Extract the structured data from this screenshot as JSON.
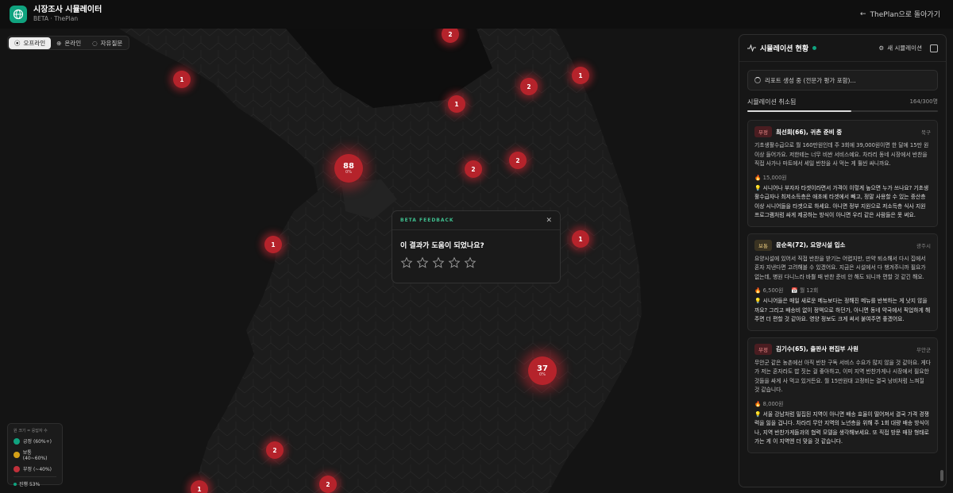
{
  "header": {
    "title": "시장조사 시뮬레이터",
    "subtitle": "BETA · ThePlan",
    "back_label": "ThePlan으로 돌아가기"
  },
  "modes": [
    {
      "label": "오프라인",
      "icon": "location-pin-icon",
      "active": true
    },
    {
      "label": "온라인",
      "icon": "globe-icon",
      "active": false
    },
    {
      "label": "자유질문",
      "icon": "chat-bubble-icon",
      "active": false
    }
  ],
  "clusters": [
    {
      "count": "2",
      "size": "sm"
    },
    {
      "count": "1",
      "size": "sm"
    },
    {
      "count": "2",
      "size": "sm"
    },
    {
      "count": "1",
      "size": "sm"
    },
    {
      "count": "1",
      "size": "sm"
    },
    {
      "count": "88",
      "pct": "0%",
      "size": "lg"
    },
    {
      "count": "2",
      "size": "sm"
    },
    {
      "count": "2",
      "size": "sm"
    },
    {
      "count": "1",
      "size": "sm"
    },
    {
      "count": "1",
      "size": "sm"
    },
    {
      "count": "37",
      "pct": "0%",
      "size": "lg"
    },
    {
      "count": "2",
      "size": "sm"
    },
    {
      "count": "2",
      "size": "sm"
    },
    {
      "count": "1",
      "size": "sm"
    }
  ],
  "legend": {
    "title": "원 크기 = 응답자 수",
    "items": [
      {
        "label": "긍정 (60%+)",
        "color": "#10a37f"
      },
      {
        "label": "보통 (40~60%)",
        "color": "#d4a017"
      },
      {
        "label": "부정 (~40%)",
        "color": "#c0303a"
      }
    ],
    "progress": "진행 53%"
  },
  "feedback": {
    "tag": "BETA FEEDBACK",
    "question": "이 결과가 도움이 되었나요?",
    "stars": 5
  },
  "panel": {
    "title": "시뮬레이션 현황",
    "new_label": "새 시뮬레이션",
    "report_status": "리포트 생성 중 (전문가 평가 포함)...",
    "cancel_label": "시뮬레이션 취소됨",
    "count_label": "164/300명",
    "progress": 0.547,
    "cards": [
      {
        "badge": "부정",
        "tone": "neg",
        "name": "최선희(66), 귀촌 준비 중",
        "location": "북구",
        "body": "기초생활수급으로 월 160만원인데 주 3회에 39,000원이면 한 달에 15만 원 이상 들어가요. 저한테는 너무 비싼 서비스예요. 차라리 동네 시장에서 반찬을 직접 사가나 마트에서 세일 반찬을 사 먹는 게 훨씬 싸니까요.",
        "price": "15,000원",
        "frequency": "",
        "tip": "시니어나 부자자 타겟이라면서 가격이 이렇게 높으면 누가 쓰나요? 기초생활수급자나 최저소득층은 애초에 타겟에서 빼고, 정말 사용할 수 있는 중산층 이상 시니어들을 타겟으로 하세요. 아니면 정부 지원으로 저소득층 식사 지원 프로그램처럼 싸게 제공하는 방식이 아니면 우리 같은 사람들은 못 써요."
      },
      {
        "badge": "보통",
        "tone": "neu",
        "name": "윤순옥(72), 요양시설 입소",
        "location": "광주시",
        "body": "요양시설에 있어서 직접 반찬을 받기는 어렵지만, 만약 퇴소해서 다시 집에서 혼자 지낸다면 고려해볼 수 있겠어요. 지금은 시설에서 다 챙겨주니까 필요가 없는데, 병원 다니느라 바쁠 때 반찬 준비 안 해도 되니까 편할 것 같긴 해요.",
        "price": "6,500원",
        "frequency": "월 12회",
        "tip": "시니어들은 매일 새로운 메뉴보다는 정해진 메뉴를 반복하는 게 낫지 않을까요? 그리고 배송비 없이 정액으로 하던가, 아니면 동네 약국에서 픽업하게 해주면 더 편할 것 같아요. 영양 정보도 크게 써서 붙여주면 좋겠어요."
      },
      {
        "badge": "부정",
        "tone": "neg",
        "name": "김기수(65), 출판사 편집부 사원",
        "location": "무안군",
        "body": "무안군 같은 농촌에선 아직 반찬 구독 서비스 수요가 많지 않을 것 같아요. 게다가 저는 혼자라도 밥 짓는 걸 좋아하고, 이미 지역 반찬가게나 시장에서 필요한 것들을 싸게 사 먹고 있거든요. 월 15만원대 고정비는 결국 낭비처럼 느껴질 것 같습니다.",
        "price": "8,000원",
        "frequency": "",
        "tip": "서울 강남처럼 밀집된 지역이 아니면 배송 효율이 떨어져서 결국 가격 경쟁력을 잃을 겁니다. 차라리 무안 지역의 노년층을 위해 주 1회 대량 배송 방식이나, 지역 반찬가게들과의 협력 모델을 생각해보세요. 또 직접 방문 매장 형태로 가는 게 이 지역엔 더 맞을 것 같습니다."
      }
    ]
  }
}
